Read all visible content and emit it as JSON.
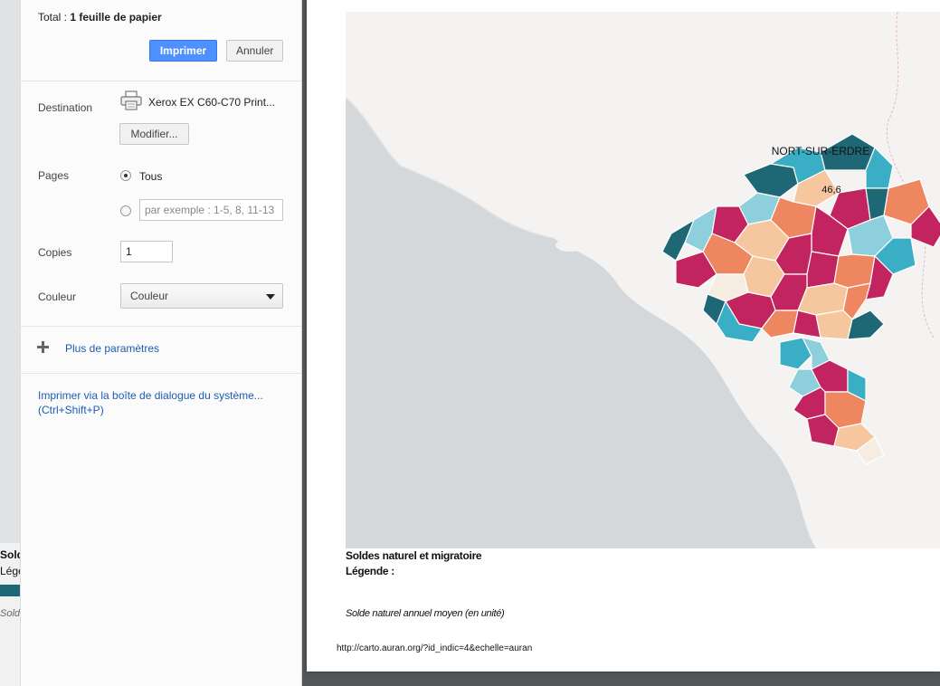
{
  "underlying": {
    "text1": "Solde",
    "text2": "Légen",
    "text3": "Solde"
  },
  "panel": {
    "total_prefix": "Total : ",
    "total_value": "1 feuille de papier",
    "print_button": "Imprimer",
    "cancel_button": "Annuler",
    "destination_label": "Destination",
    "printer_name": "Xerox EX C60-C70 Print...",
    "modify_button": "Modifier...",
    "pages_label": "Pages",
    "pages_all": "Tous",
    "pages_placeholder": "par exemple : 1-5, 8, 11-13",
    "copies_label": "Copies",
    "copies_value": "1",
    "color_label": "Couleur",
    "color_value": "Couleur",
    "more_settings": "Plus de paramètres",
    "system_dialog": "Imprimer via la boîte de dialogue du système...",
    "system_dialog_shortcut": "(Ctrl+Shift+P)"
  },
  "preview": {
    "map_place_label": "NORT-SUR-ERDRE",
    "map_value_label": "46,6",
    "caption_title": "Soldes naturel et migratoire",
    "caption_legend": "Légende :",
    "caption_indicator": "Solde naturel annuel moyen (en unité)",
    "url": "http://carto.auran.org/?id_indic=4&echelle=auran"
  },
  "colors": {
    "accent_blue": "#4d90fe",
    "link_blue": "#1c5cb3",
    "map_dark_teal": "#1e6774",
    "map_teal": "#3aaec4",
    "map_light_blue": "#8dcfdd",
    "map_magenta": "#c1245e",
    "map_orange": "#ee8660",
    "map_peach": "#f6c79f",
    "map_cream": "#f7ece2"
  }
}
